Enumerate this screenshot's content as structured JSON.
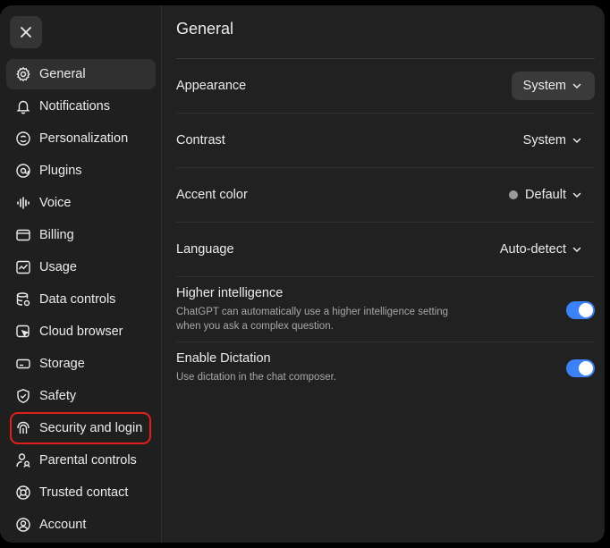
{
  "sidebar": {
    "items": [
      {
        "label": "General",
        "icon": "gear-icon",
        "active": true
      },
      {
        "label": "Notifications",
        "icon": "bell-icon"
      },
      {
        "label": "Personalization",
        "icon": "personalization-icon"
      },
      {
        "label": "Plugins",
        "icon": "plugins-icon"
      },
      {
        "label": "Voice",
        "icon": "waveform-icon"
      },
      {
        "label": "Billing",
        "icon": "credit-card-icon"
      },
      {
        "label": "Usage",
        "icon": "usage-chart-icon"
      },
      {
        "label": "Data controls",
        "icon": "database-icon"
      },
      {
        "label": "Cloud browser",
        "icon": "cloud-browser-icon"
      },
      {
        "label": "Storage",
        "icon": "storage-icon"
      },
      {
        "label": "Safety",
        "icon": "shield-icon"
      },
      {
        "label": "Security and login",
        "icon": "security-icon",
        "highlighted": true
      },
      {
        "label": "Parental controls",
        "icon": "parental-icon"
      },
      {
        "label": "Trusted contact",
        "icon": "lifebuoy-icon"
      },
      {
        "label": "Account",
        "icon": "account-icon"
      }
    ]
  },
  "main": {
    "title": "General",
    "settings": [
      {
        "label": "Appearance",
        "value": "System",
        "style": "boxed"
      },
      {
        "label": "Contrast",
        "value": "System"
      },
      {
        "label": "Accent color",
        "value": "Default",
        "dot_color": "#9a9a9a"
      },
      {
        "label": "Language",
        "value": "Auto-detect"
      }
    ],
    "toggles": [
      {
        "title": "Higher intelligence",
        "desc": "ChatGPT can automatically use a higher intelligence setting when you ask a complex question.",
        "on": true
      },
      {
        "title": "Enable Dictation",
        "desc": "Use dictation in the chat composer.",
        "on": true
      }
    ]
  },
  "colors": {
    "accent": "#3b82f6",
    "highlight": "#e0201b"
  }
}
